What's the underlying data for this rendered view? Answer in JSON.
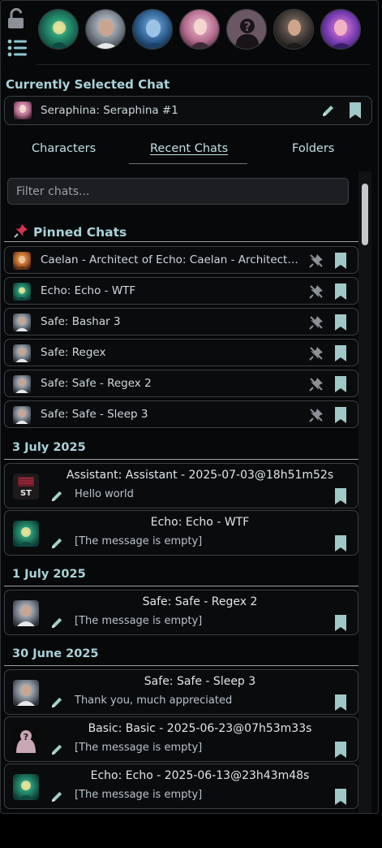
{
  "colors": {
    "accent": "#a9d2da",
    "bookmark": "#9fc8c8",
    "pin_red": "#d0344f",
    "panel": "#070809"
  },
  "current": {
    "heading": "Currently Selected Chat",
    "chat_label": "Seraphina: Seraphina #1"
  },
  "tabs": {
    "characters": "Characters",
    "recent": "Recent Chats",
    "folders": "Folders"
  },
  "filter": {
    "placeholder": "Filter chats..."
  },
  "pinned": {
    "heading": "Pinned Chats",
    "items": [
      {
        "label": "Caelan - Architect of Echo: Caelan - Architect of Echo",
        "avatar": "caelan"
      },
      {
        "label": "Echo: Echo - WTF",
        "avatar": "echo"
      },
      {
        "label": "Safe: Bashar 3",
        "avatar": "safe"
      },
      {
        "label": "Safe: Regex",
        "avatar": "safe"
      },
      {
        "label": "Safe: Safe - Regex 2",
        "avatar": "safe"
      },
      {
        "label": "Safe: Safe - Sleep 3",
        "avatar": "safe"
      }
    ]
  },
  "groups": [
    {
      "date": "3 July 2025",
      "chats": [
        {
          "title": "Assistant: Assistant - 2025-07-03@18h51m52s",
          "message": "Hello world",
          "avatar": "assistant"
        },
        {
          "title": "Echo: Echo - WTF",
          "message": "[The message is empty]",
          "avatar": "echo"
        }
      ]
    },
    {
      "date": "1 July 2025",
      "chats": [
        {
          "title": "Safe: Safe - Regex 2",
          "message": "[The message is empty]",
          "avatar": "safe"
        }
      ]
    },
    {
      "date": "30 June 2025",
      "chats": [
        {
          "title": "Safe: Safe - Sleep 3",
          "message": "Thank you, much appreciated",
          "avatar": "safe"
        },
        {
          "title": "Basic: Basic - 2025-06-23@07h53m33s",
          "message": "[The message is empty]",
          "avatar": "basic"
        },
        {
          "title": "Echo: Echo - 2025-06-13@23h43m48s",
          "message": "[The message is empty]",
          "avatar": "echo"
        }
      ]
    }
  ],
  "assistant_avatar_text": "ST"
}
